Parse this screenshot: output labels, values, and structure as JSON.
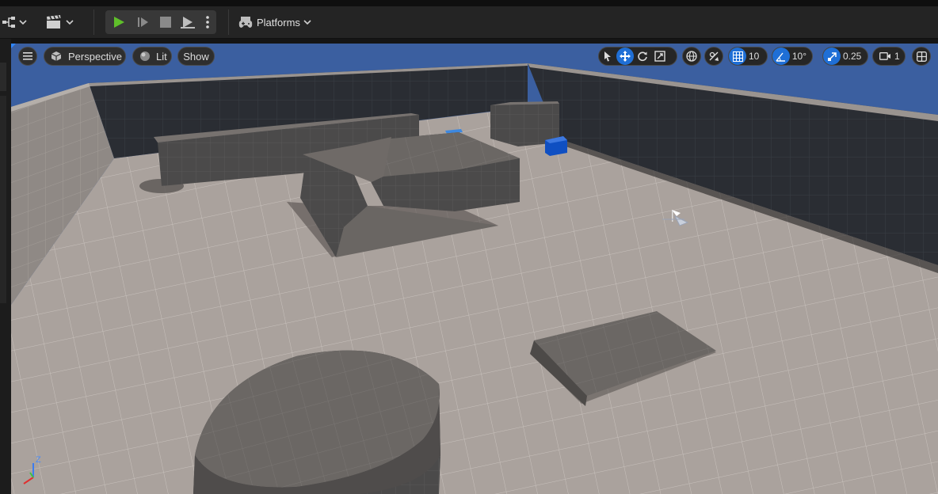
{
  "toolbar": {
    "platforms_label": "Platforms",
    "icons": [
      "hierarchy-icon",
      "clapperboard-icon",
      "play-icon",
      "step-icon",
      "stop-icon",
      "eject-icon",
      "more-icon",
      "gamepad-icon"
    ]
  },
  "viewport": {
    "view_mode": "Perspective",
    "lighting_mode": "Lit",
    "show_label": "Show",
    "grid_snap_value": "10",
    "rotation_snap_value": "10°",
    "scale_snap_value": "0.25",
    "camera_speed_value": "1",
    "axis_labels": {
      "z": "Z"
    }
  },
  "colors": {
    "accent": "#1f6fd6",
    "play_green": "#5fbf2a",
    "sky": "#3b5fa0",
    "floor": "#aaa29d",
    "wall": "#2a2d33",
    "cube_blue": "#0f4fc2"
  }
}
